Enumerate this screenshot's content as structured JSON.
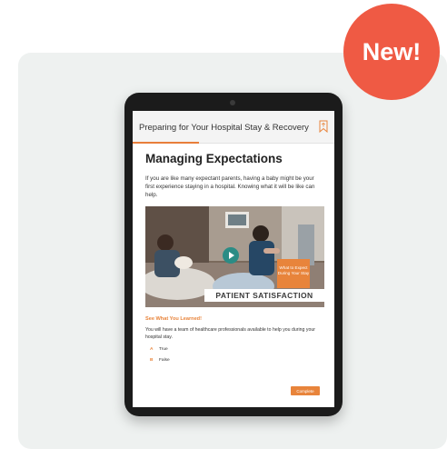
{
  "badge": {
    "label": "New!"
  },
  "course": {
    "title": "Preparing for Your Hospital Stay & Recovery",
    "progress_fraction": 0.33,
    "bookmark_icon": "bookmark-icon"
  },
  "lesson": {
    "heading": "Managing Expectations",
    "intro": "If you are like many expectant parents, having a baby might be your first experience staying in a hospital. Knowing what it will be like can help."
  },
  "video": {
    "card_text": "What to Expect During Your Stay",
    "banner": "PATIENT SATISFACTION",
    "play_icon": "play-icon"
  },
  "quiz": {
    "heading": "See What You Learned!",
    "question": "You will have a team of healthcare professionals available to help you during your hospital stay.",
    "options": [
      {
        "letter": "A",
        "label": "True"
      },
      {
        "letter": "B",
        "label": "False"
      }
    ],
    "complete_label": "Complete"
  },
  "colors": {
    "accent": "#e8843b",
    "badge": "#ef5a44",
    "play": "#2b8c85"
  }
}
